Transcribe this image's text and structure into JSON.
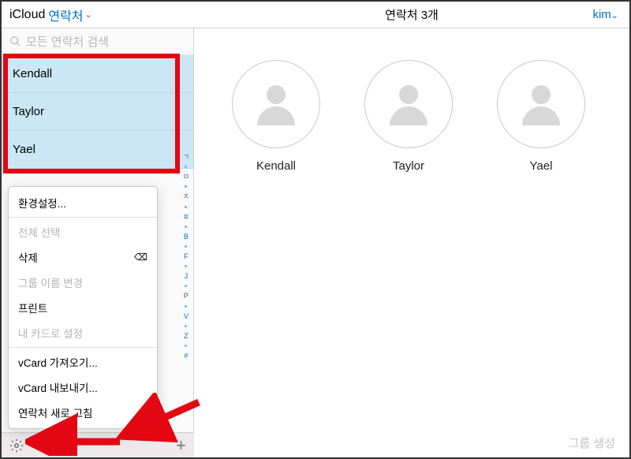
{
  "header": {
    "icloud": "iCloud",
    "contacts_dropdown": "연락처",
    "count_text": "연락처 3개",
    "user": "kim"
  },
  "search": {
    "placeholder": "모든 연락처 검색"
  },
  "contacts": [
    {
      "name": "Kendall"
    },
    {
      "name": "Taylor"
    },
    {
      "name": "Yael"
    }
  ],
  "index_rail": [
    "ㄱ",
    "ㅁ",
    "ㅈ",
    "ㅍ",
    "B",
    "F",
    "J",
    "P",
    "V",
    "Z",
    "#"
  ],
  "popup": {
    "prefs": "환경설정...",
    "select_all": "전체 선택",
    "delete": "삭제",
    "rename_group": "그룹 이름 변경",
    "print": "프린트",
    "set_my_card": "내 카드로 설정",
    "vcard_import": "vCard 가져오기...",
    "vcard_export": "vCard 내보내기...",
    "refresh": "연락처 새로 고침"
  },
  "cards": [
    {
      "name": "Kendall"
    },
    {
      "name": "Taylor"
    },
    {
      "name": "Yael"
    }
  ],
  "footer": {
    "group_create": "그룹 생성"
  }
}
